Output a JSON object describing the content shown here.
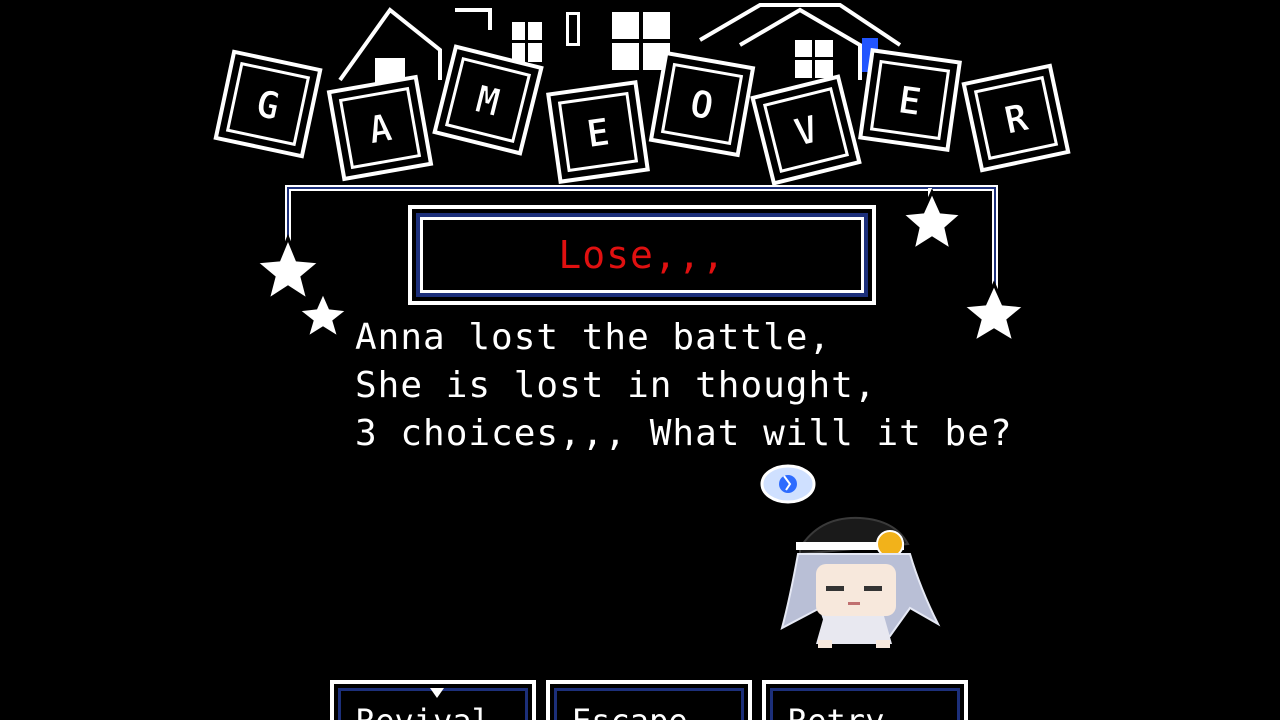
{
  "title": {
    "letters": [
      "G",
      "A",
      "M",
      "E",
      "O",
      "V",
      "E",
      "R"
    ]
  },
  "result": {
    "label": "Lose,,,"
  },
  "narrative": {
    "lines": [
      "Anna lost the battle,",
      "She is lost in thought,",
      "3 choices,,, What will it be?"
    ]
  },
  "character": {
    "name": "Anna",
    "thought_icon": "thought-bubble-icon"
  },
  "choices": [
    {
      "label": "Revival"
    },
    {
      "label": "Escape"
    },
    {
      "label": "Retry"
    }
  ],
  "colors": {
    "background": "#000000",
    "frame": "#ffffff",
    "frame_accent": "#1c2f7a",
    "result_text": "#e01010",
    "text": "#ffffff",
    "accent_dot": "#1e5cff"
  }
}
